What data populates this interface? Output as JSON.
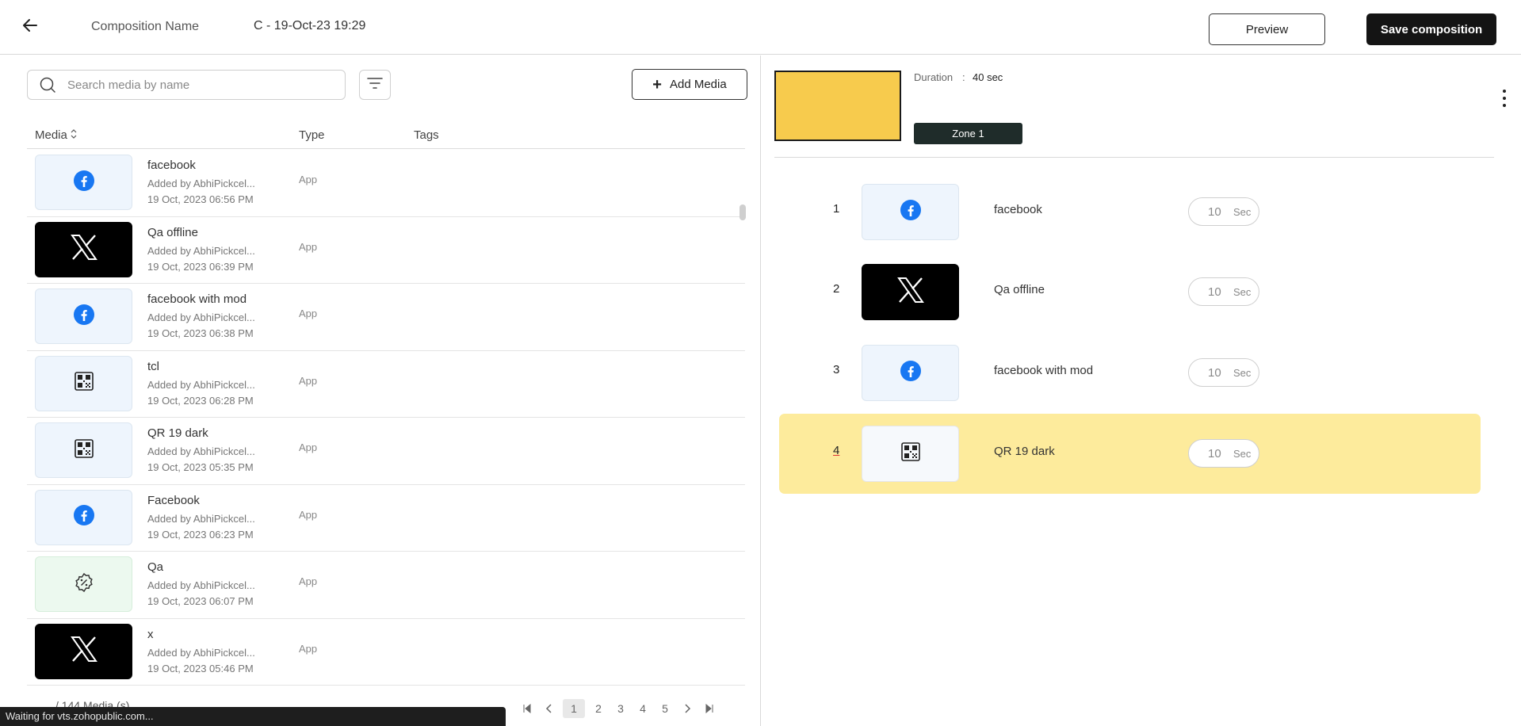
{
  "header": {
    "composition_label": "Composition Name",
    "composition_value": "C - 19-Oct-23 19:29",
    "preview_label": "Preview",
    "save_label": "Save composition"
  },
  "left": {
    "search_placeholder": "Search media by name",
    "add_media_label": "Add Media",
    "columns": {
      "media": "Media",
      "type": "Type",
      "tags": "Tags"
    },
    "rows": [
      {
        "name": "facebook",
        "added_by": "Added by AbhiPickcel...",
        "date": "19 Oct, 2023 06:56 PM",
        "type": "App",
        "icon": "facebook-icon"
      },
      {
        "name": "Qa offline",
        "added_by": "Added by AbhiPickcel...",
        "date": "19 Oct, 2023 06:39 PM",
        "type": "App",
        "icon": "x-logo-icon"
      },
      {
        "name": "facebook with mod",
        "added_by": "Added by AbhiPickcel...",
        "date": "19 Oct, 2023 06:38 PM",
        "type": "App",
        "icon": "facebook-icon"
      },
      {
        "name": "tcl",
        "added_by": "Added by AbhiPickcel...",
        "date": "19 Oct, 2023 06:28 PM",
        "type": "App",
        "icon": "qr-code-icon"
      },
      {
        "name": "QR 19 dark",
        "added_by": "Added by AbhiPickcel...",
        "date": "19 Oct, 2023 05:35 PM",
        "type": "App",
        "icon": "qr-code-icon"
      },
      {
        "name": "Facebook",
        "added_by": "Added by AbhiPickcel...",
        "date": "19 Oct, 2023 06:23 PM",
        "type": "App",
        "icon": "facebook-icon"
      },
      {
        "name": "Qa",
        "added_by": "Added by AbhiPickcel...",
        "date": "19 Oct, 2023 06:07 PM",
        "type": "App",
        "icon": "discount-badge-icon"
      },
      {
        "name": "x",
        "added_by": "Added by AbhiPickcel...",
        "date": "19 Oct, 2023 05:46 PM",
        "type": "App",
        "icon": "x-logo-icon"
      }
    ],
    "footer_count": "/ 144 Media (s)",
    "pages": [
      "1",
      "2",
      "3",
      "4",
      "5"
    ],
    "current_page": "1"
  },
  "right": {
    "duration_label": "Duration",
    "duration_sep": ":",
    "duration_value": "40 sec",
    "zone_label": "Zone 1",
    "preview_color": "#f7cb4d",
    "items": [
      {
        "index": "1",
        "name": "facebook",
        "duration": "10",
        "unit": "Sec",
        "icon": "facebook-icon"
      },
      {
        "index": "2",
        "name": "Qa offline",
        "duration": "10",
        "unit": "Sec",
        "icon": "x-logo-icon"
      },
      {
        "index": "3",
        "name": "facebook with mod",
        "duration": "10",
        "unit": "Sec",
        "icon": "facebook-icon"
      },
      {
        "index": "4",
        "name": "QR 19 dark",
        "duration": "10",
        "unit": "Sec",
        "icon": "qr-code-icon"
      }
    ]
  },
  "status_bar": "Waiting for vts.zohopublic.com..."
}
